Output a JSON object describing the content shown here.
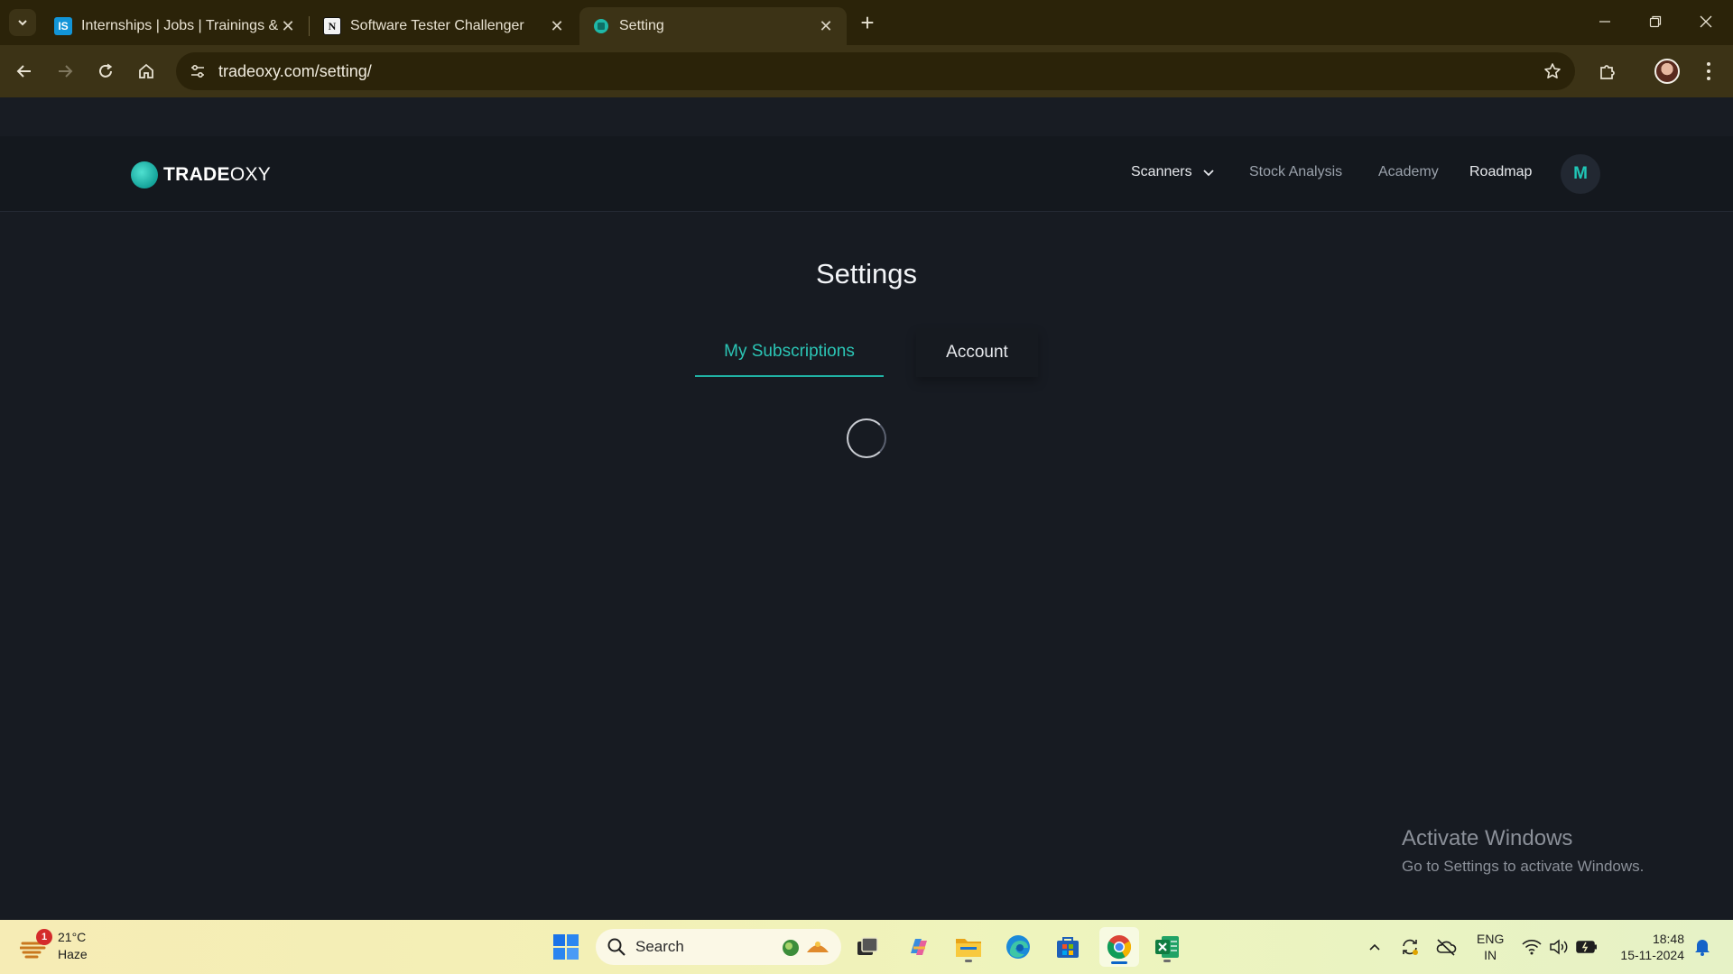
{
  "browser": {
    "tabs": [
      {
        "title": "Internships | Jobs | Trainings & E",
        "favicon": "internshala-favicon",
        "favicon_text": "IS",
        "active": false
      },
      {
        "title": "Software Tester Challenger",
        "favicon": "notion-favicon",
        "favicon_text": "N",
        "active": false
      },
      {
        "title": "Setting",
        "favicon": "tradeoxy-favicon",
        "active": true
      }
    ],
    "url": "tradeoxy.com/setting/"
  },
  "site": {
    "logo": {
      "bold": "TRADE",
      "light": "OXY"
    },
    "nav": [
      {
        "label": "Scanners",
        "has_dropdown": true,
        "color": "#e6e8ec"
      },
      {
        "label": "Stock Analysis",
        "color": "#9aa1ab"
      },
      {
        "label": "Academy",
        "color": "#9aa1ab"
      },
      {
        "label": "Roadmap",
        "color": "#e6e8ec"
      }
    ],
    "avatar_initial": "M",
    "accent_color": "#20b2a4"
  },
  "settings": {
    "title": "Settings",
    "tabs": [
      {
        "label": "My Subscriptions",
        "active": true
      },
      {
        "label": "Account",
        "active": false
      }
    ],
    "loading": true
  },
  "watermark": {
    "title": "Activate Windows",
    "subtitle": "Go to Settings to activate Windows."
  },
  "taskbar": {
    "weather": {
      "temp": "21°C",
      "condition": "Haze",
      "badge": "1"
    },
    "search_label": "Search",
    "apps": [
      "start-icon",
      "task-view-icon",
      "copilot-icon",
      "file-explorer-icon",
      "edge-icon",
      "store-icon",
      "chrome-icon",
      "excel-icon"
    ],
    "lang": {
      "line1": "ENG",
      "line2": "IN"
    },
    "clock": {
      "time": "18:48",
      "date": "15-11-2024"
    }
  }
}
